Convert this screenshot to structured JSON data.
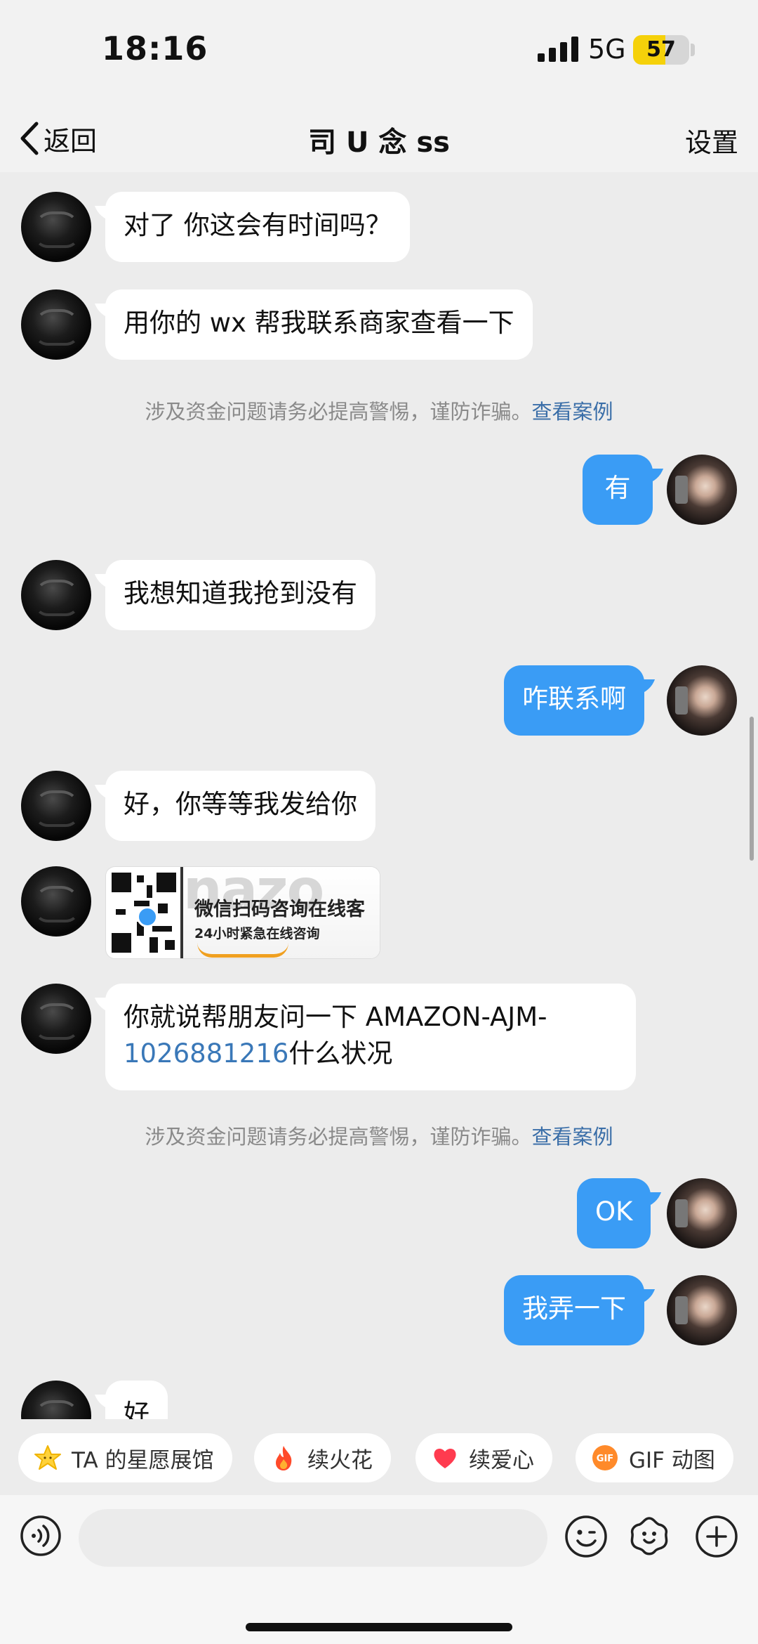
{
  "status_bar": {
    "time": "18:16",
    "network": "5G",
    "battery": "57",
    "battery_level": 0.57
  },
  "nav": {
    "back_label": "返回",
    "title": "司 U 念 ss",
    "settings_label": "设置"
  },
  "messages": {
    "m1": "对了 你这会有时间吗？",
    "m2": "用你的 wx 帮我联系商家查看一下",
    "notice1": {
      "text": "涉及资金问题请务必提高警惕，谨防诈骗。",
      "link": "查看案例"
    },
    "m3": "有",
    "m4": "我想知道我抢到没有",
    "m5": "咋联系啊",
    "m6": "好，你等等我发给你",
    "image_card": {
      "bg_text": "nazo",
      "title": "微信扫码咨询在线客",
      "subtitle": "24小时紧急在线咨询"
    },
    "m7": {
      "part1": "你就说帮朋友问一下 AMAZON-AJM-",
      "number": "1026881216",
      "part2": "什么状况"
    },
    "notice2": {
      "text": "涉及资金问题请务必提高警惕，谨防诈骗。",
      "link": "查看案例"
    },
    "m8": "OK",
    "m9": "我弄一下",
    "m10": "好"
  },
  "quick_actions": [
    {
      "label": "TA 的星愿展馆",
      "icon": "star-icon"
    },
    {
      "label": "续火花",
      "icon": "fire-icon"
    },
    {
      "label": "续爱心",
      "icon": "heart-icon"
    },
    {
      "label": "GIF 动图",
      "icon": "gif-icon"
    }
  ],
  "input": {
    "placeholder": ""
  },
  "colors": {
    "accent_blue": "#3a9cf5",
    "link_blue": "#3a6ea8",
    "battery_yellow": "#f5d10a"
  }
}
